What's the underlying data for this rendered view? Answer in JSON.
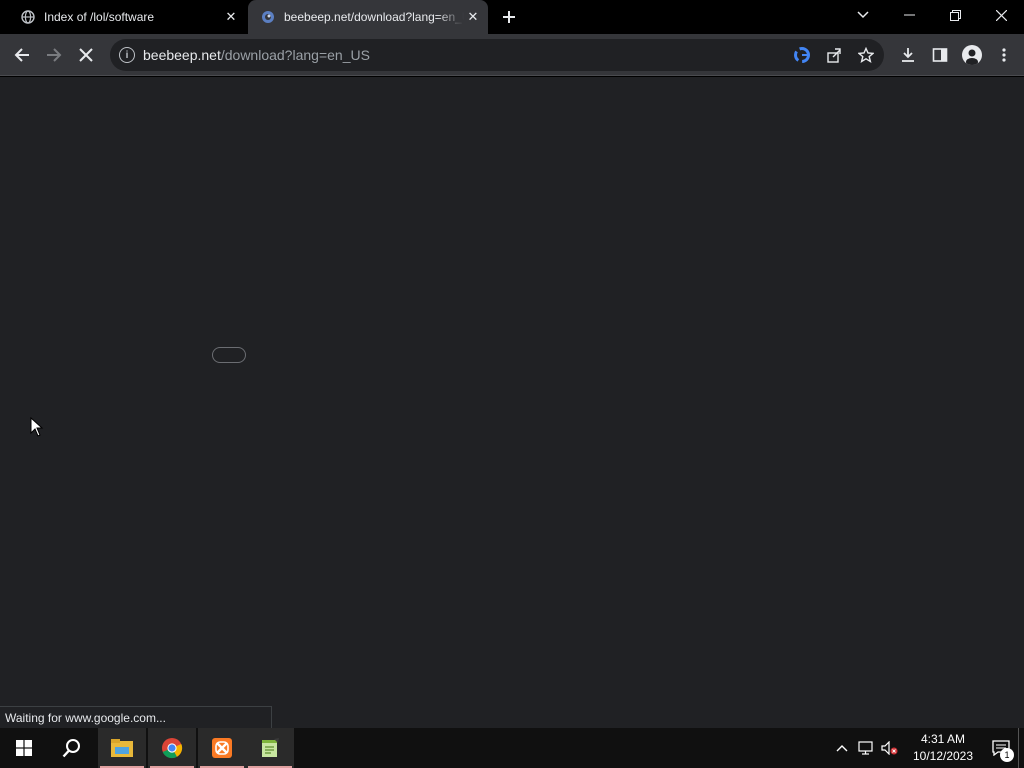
{
  "browser": {
    "tabs": [
      {
        "title": "Index of /lol/software",
        "favicon": "globe-icon",
        "active": false
      },
      {
        "title": "beebeep.net/download?lang=en_US",
        "favicon": "beebeep-favicon-icon",
        "active": true
      }
    ],
    "omnibox": {
      "host": "beebeep.net",
      "path": "/download?lang=en_US"
    },
    "status_text": "Waiting for www.google.com..."
  },
  "taskbar": {
    "apps": [
      "start-icon",
      "search-icon",
      "file-explorer-icon",
      "chrome-icon",
      "xampp-icon",
      "notepad-plus-icon"
    ],
    "clock": {
      "time": "4:31 AM",
      "date": "10/12/2023"
    },
    "notification_count": "1"
  },
  "colors": {
    "tabstrip_bg": "#000000",
    "toolbar_bg": "#35363a",
    "omnibox_bg": "#202124",
    "content_bg": "#202124",
    "taskbar_bg": "#101010"
  }
}
